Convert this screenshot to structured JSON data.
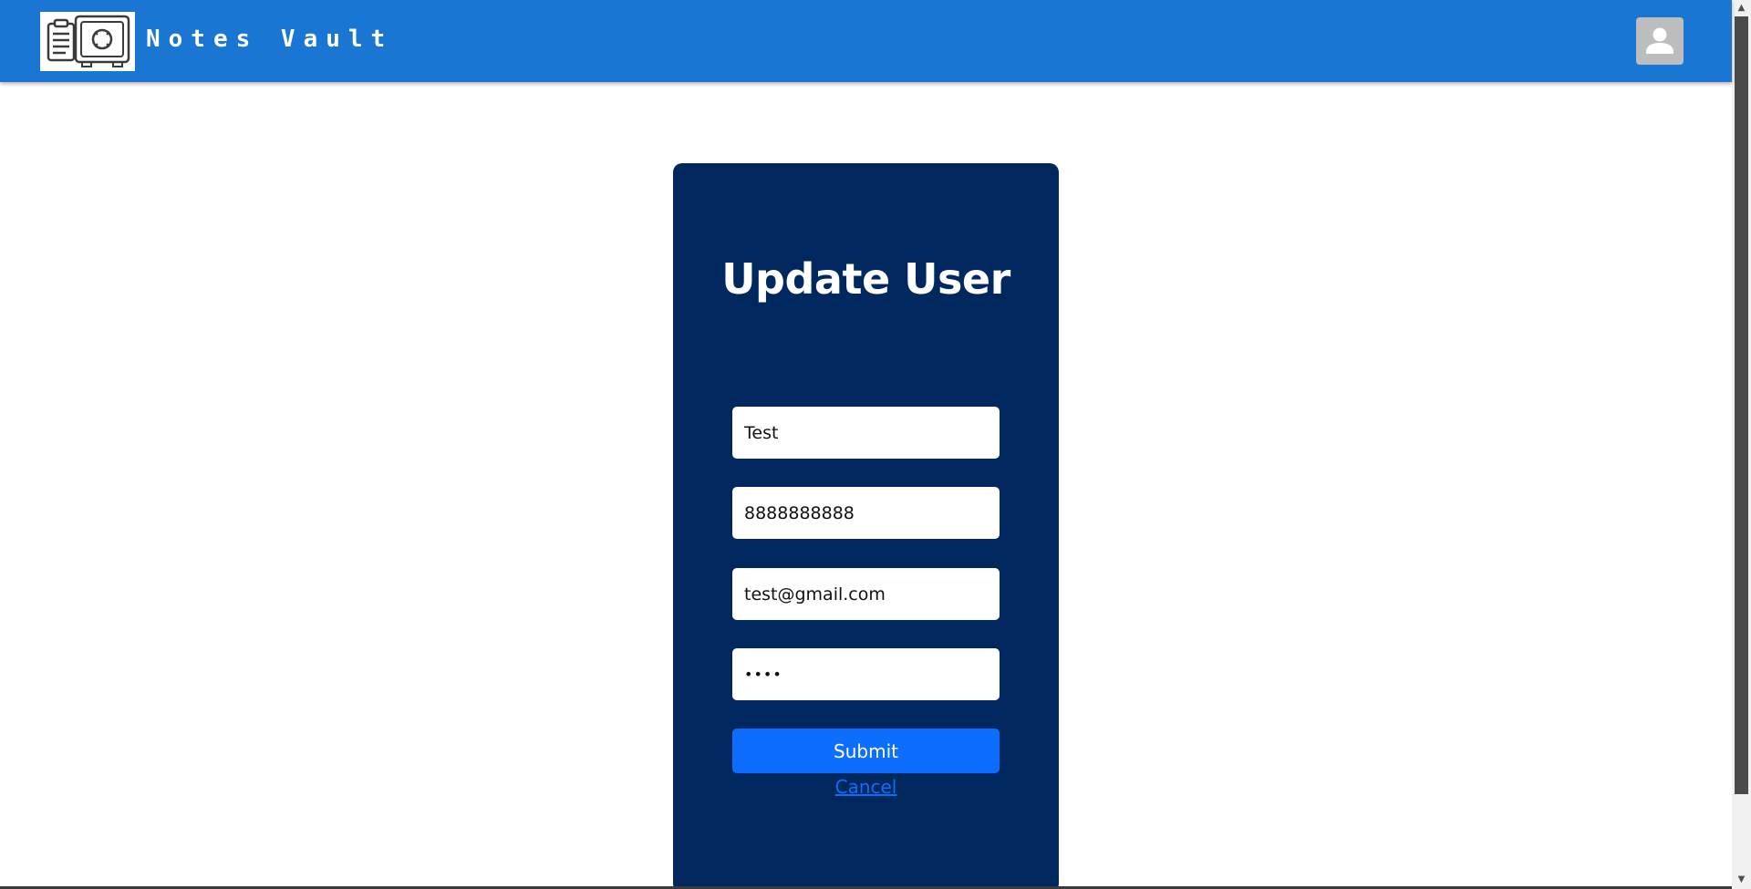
{
  "app": {
    "title": "Notes Vault",
    "logo_icon": "notes-safe-icon",
    "avatar_icon": "user-avatar-icon"
  },
  "form": {
    "title": "Update User",
    "fields": {
      "name": "Test",
      "phone": "8888888888",
      "email": "test@gmail.com",
      "password": "••••"
    },
    "submit_label": "Submit",
    "cancel_label": "Cancel"
  },
  "colors": {
    "header_bg": "#1976d2",
    "card_bg": "#00285e",
    "button_bg": "#0d6efd",
    "link": "#0d6efd",
    "avatar_bg": "#bdbdbd"
  }
}
